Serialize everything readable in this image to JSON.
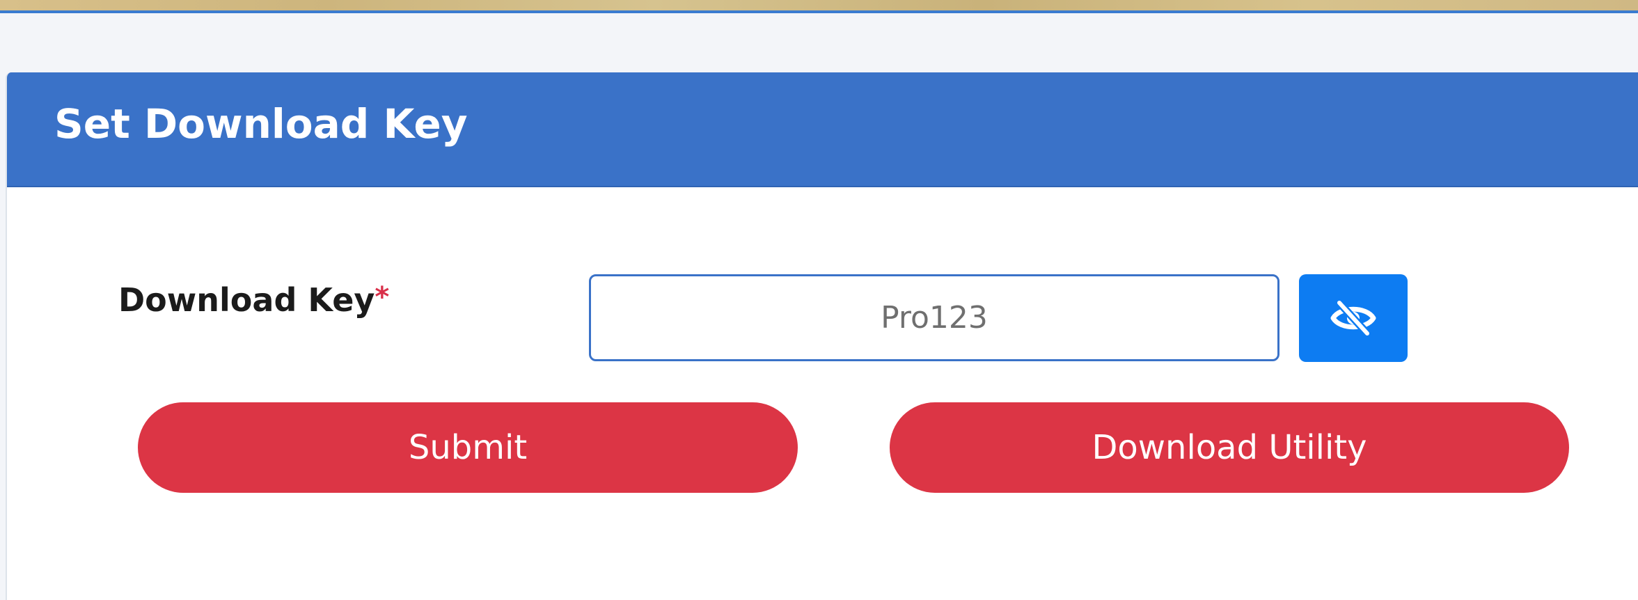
{
  "panel": {
    "title": "Set Download Key"
  },
  "form": {
    "download_key_label": "Download Key",
    "required_marker": "*",
    "download_key_value": "Pro123",
    "toggle_icon": "eye-slash-icon"
  },
  "actions": {
    "submit_label": "Submit",
    "download_utility_label": "Download Utility"
  },
  "colors": {
    "header_bg": "#3a72c8",
    "toggle_bg": "#0d7cf2",
    "button_bg": "#dc3545",
    "required": "#d9304a"
  }
}
